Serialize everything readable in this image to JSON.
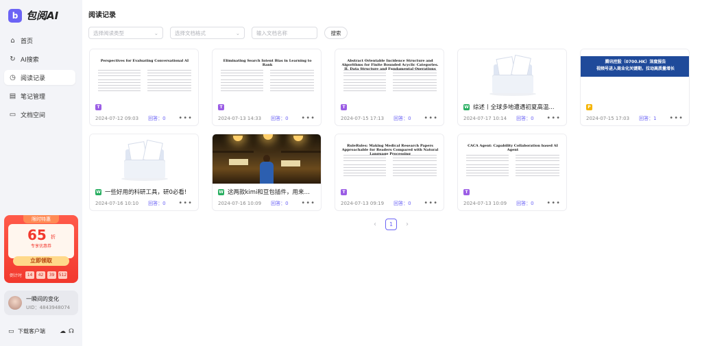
{
  "app": {
    "brand_icon": "b",
    "brand_name": "包阅AI"
  },
  "nav": [
    {
      "label": "首页",
      "icon": "home-icon",
      "glyph": "⌂",
      "active": false
    },
    {
      "label": "AI搜索",
      "icon": "ai-search-icon",
      "glyph": "↻",
      "active": false
    },
    {
      "label": "阅读记录",
      "icon": "clock-icon",
      "glyph": "◷",
      "active": true
    },
    {
      "label": "笔记管理",
      "icon": "notes-icon",
      "glyph": "▤",
      "active": false
    },
    {
      "label": "文档空间",
      "icon": "folder-icon",
      "glyph": "▭",
      "active": false
    }
  ],
  "promo": {
    "tag": "限时特惠",
    "discount": "65",
    "unit": "折",
    "sub": "专享优惠券",
    "button": "立即领取",
    "countdown_label": "倒计时",
    "countdown": [
      "14",
      "42",
      "39",
      "512"
    ]
  },
  "user": {
    "name": "一瞬间的变化",
    "uid": "UID：4843948074"
  },
  "footer": {
    "download": "下载客户端"
  },
  "page": {
    "title": "阅读记录",
    "filters": {
      "read_type_placeholder": "选择阅读类型",
      "doc_format_placeholder": "选择文档格式",
      "doc_name_placeholder": "输入文档名称",
      "search_button": "搜索"
    }
  },
  "cards": [
    {
      "thumb": "paper",
      "paper_title": "Perspectives for Evaluating Conversational AI",
      "badge": "T",
      "badge_color": "#9b5de5",
      "name": "",
      "date": "2024-07-12 09:03",
      "answers": "回答：0"
    },
    {
      "thumb": "paper",
      "paper_title": "Eliminating Search Intent Bias in Learning to Rank",
      "badge": "T",
      "badge_color": "#9b5de5",
      "name": "",
      "date": "2024-07-13 14:33",
      "answers": "回答：0"
    },
    {
      "thumb": "paper",
      "paper_title": "Abstract Orientable Incidence Structure and Algorithms for Finite Bounded Acyclic Categories. II. Data Structure and Fundamental Operations",
      "badge": "T",
      "badge_color": "#9b5de5",
      "name": "",
      "date": "2024-07-15 17:13",
      "answers": "回答：0"
    },
    {
      "thumb": "folder",
      "paper_title": "",
      "badge": "W",
      "badge_color": "#27ae60",
      "name": "综述丨全球多地遭遇初夏高温...",
      "date": "2024-07-17 10:14",
      "answers": "回答：0"
    },
    {
      "thumb": "report",
      "paper_title": "腾讯控股（0700.HK）深度报告",
      "report_sub": "视频号进入商业化关键期，拉动高质量增长",
      "badge": "P",
      "badge_color": "#f5b400",
      "name": "",
      "date": "2024-07-15 17:03",
      "answers": "回答：1"
    },
    {
      "thumb": "folder",
      "paper_title": "",
      "badge": "W",
      "badge_color": "#27ae60",
      "name": "一些好用的科研工具，研0必看!",
      "date": "2024-07-16 10:10",
      "answers": "回答：0"
    },
    {
      "thumb": "photo",
      "paper_title": "",
      "badge": "W",
      "badge_color": "#27ae60",
      "name": "这两款kimi和豆包插件，用来辅...",
      "date": "2024-07-16 10:09",
      "answers": "回答：0"
    },
    {
      "thumb": "paper",
      "paper_title": "RuleRules: Making Medical Research Papers Approachable for Readers Compared with Natural Language Processing",
      "badge": "T",
      "badge_color": "#9b5de5",
      "name": "",
      "date": "2024-07-13 09:19",
      "answers": "回答：0"
    },
    {
      "thumb": "paper",
      "paper_title": "CACA Agent: Capability Collaboration based AI Agent",
      "badge": "T",
      "badge_color": "#9b5de5",
      "name": "",
      "date": "2024-07-13 10:09",
      "answers": "回答：0"
    }
  ],
  "pagination": {
    "current": "1",
    "prev": "‹",
    "next": "›"
  }
}
